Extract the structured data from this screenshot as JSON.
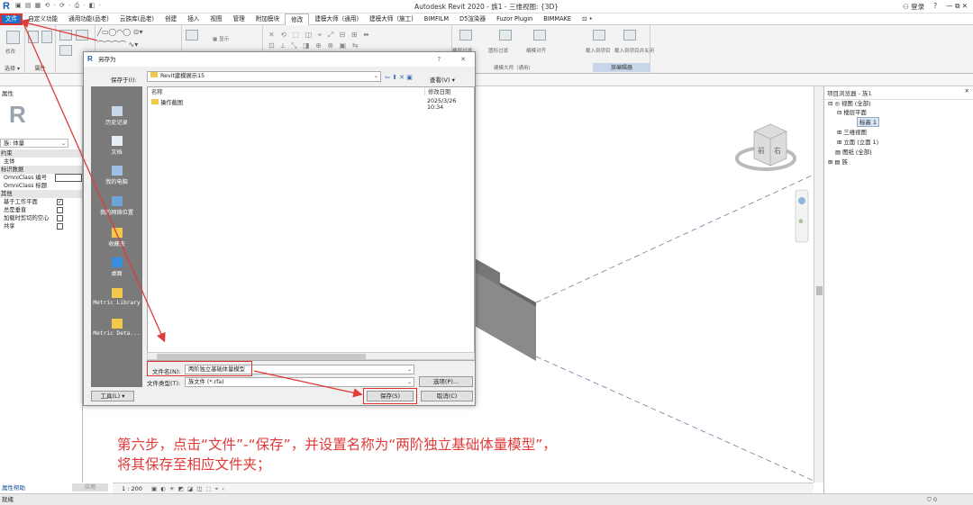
{
  "titlebar": {
    "title": "Autodesk Revit 2020 - 族1 - 三维视图: {3D}",
    "logo": "R",
    "qat": "▣ ▤ ▦ ⟲ · ⟳ · ⎙ · ◧ ·",
    "login": "登录",
    "help": "?",
    "controls": "— ⧉ ✕"
  },
  "menu": {
    "tabs": [
      "文件",
      "自定义功能",
      "通用功能(品老)",
      "云族库(品老)",
      "创建",
      "插入",
      "视图",
      "管理",
      "附加模块",
      "修改",
      "建模大师（通用)",
      "建模大师（施工)",
      "BIMFILM",
      "D5渲染器",
      "Fuzor Plugin",
      "BIMMAKE",
      "⊡ •"
    ]
  },
  "ribbon": {
    "modify_label": "修改",
    "select_label": "选择 ▾",
    "props_label": "属性",
    "jianmo_label": "建模大师（通用)",
    "family_editor_label": "族编辑器",
    "items": [
      "楼层过滤",
      "图形过滤",
      "编模对齐",
      "载入到项目",
      "载入到项目并关闭"
    ]
  },
  "properties": {
    "header": "属性",
    "type_selector": "族: 体量",
    "rows": [
      {
        "label": "约束",
        "section": true
      },
      {
        "label": "主体",
        "section": false
      },
      {
        "label": "标识数据",
        "section": true
      },
      {
        "label": "OmniClass 编号",
        "section": false
      },
      {
        "label": "OmniClass 标题",
        "section": false
      },
      {
        "label": "其他",
        "section": true
      },
      {
        "label": "基于工作平面",
        "section": false,
        "checked": "✓"
      },
      {
        "label": "总是垂直",
        "section": false,
        "checked": ""
      },
      {
        "label": "加载时剪切的空心",
        "section": false,
        "checked": ""
      },
      {
        "label": "共享",
        "section": false,
        "checked": ""
      }
    ],
    "help": "属性帮助",
    "apply": "应用"
  },
  "browser": {
    "header": "项目浏览器 - 族1",
    "close": "✕",
    "nodes": [
      "⊟ ◎ 视图 (全部)",
      "⊟ 楼层平面",
      "标高 1",
      "⊞ 三维视图",
      "⊞ 立面 (立面 1)",
      "▤ 图纸 (全部)",
      "⊞ ▤ 族"
    ]
  },
  "viewcube": {
    "face1": "前",
    "face2": "右"
  },
  "view_control": {
    "scale": "1 : 200"
  },
  "statusbar": {
    "text": "就绪",
    "right": "⛉ 0"
  },
  "dialog": {
    "title": "另存为",
    "controls": [
      "?",
      "✕"
    ],
    "save_in_label": "保存于(I):",
    "save_in_value": "Revit建模展示15",
    "view_label": "查看(V) ▾",
    "col_name": "名称",
    "col_date": "修改日期",
    "files": [
      {
        "name": "操作截图",
        "date": "2025/3/26 10:34"
      }
    ],
    "places": [
      "历史记录",
      "文档",
      "我的电脑",
      "我的网络位置",
      "收藏夹",
      "桌面",
      "Metric Library",
      "Metric Deta..."
    ],
    "filename_label": "文件名(N):",
    "filename_value": "两阶独立基础体量模型",
    "filetype_label": "文件类型(T):",
    "filetype_value": "族文件 (*.rfa)",
    "options_btn": "选项(P)...",
    "tools_btn": "工具(L)  ▾",
    "save_btn": "保存(S)",
    "cancel_btn": "取消(C)"
  },
  "annotation": {
    "line1": "第六步，点击“文件”-“保存”，并设置名称为“两阶独立基础体量模型”，",
    "line2": "将其保存至相应文件夹；"
  },
  "colors": {
    "accent": "#1a6fc9",
    "annotation": "#e03a3a",
    "places_bg": "#7a7a7a"
  }
}
